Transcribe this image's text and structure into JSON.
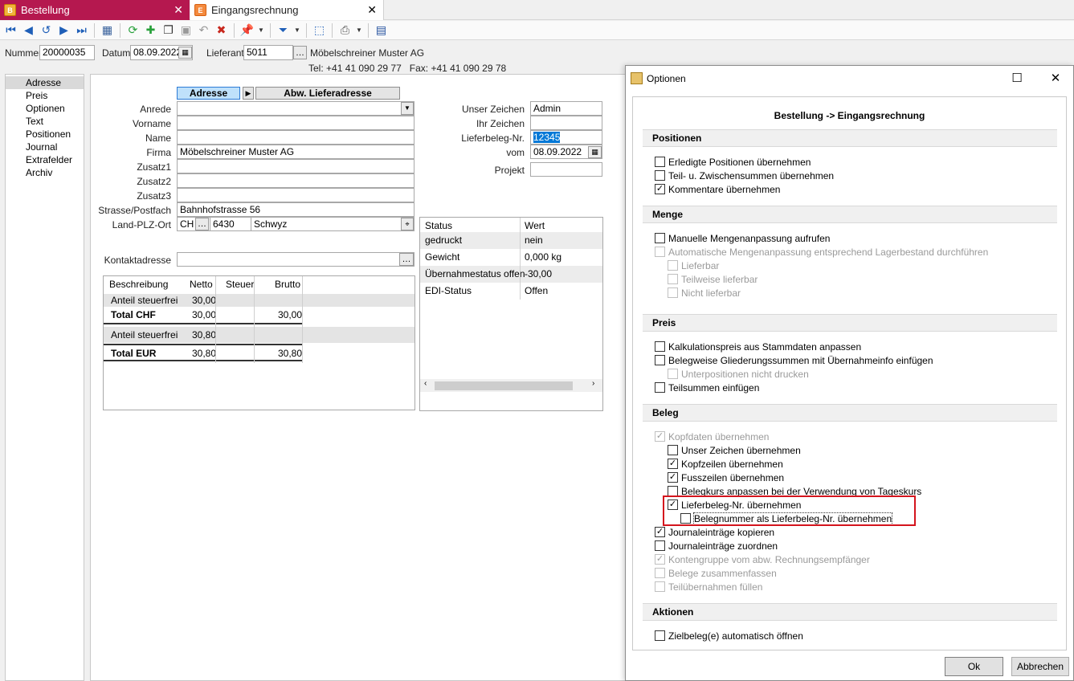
{
  "tabs": [
    {
      "label": "Bestellung",
      "icon": "document-icon",
      "active": true
    },
    {
      "label": "Eingangsrechnung",
      "icon": "document-icon",
      "active": false
    }
  ],
  "header": {
    "nummer_label": "Nummer",
    "nummer_value": "20000035",
    "datum_label": "Datum",
    "datum_value": "08.09.2022",
    "lieferant_label": "Lieferant",
    "lieferant_value": "5011",
    "lieferant_name": "Möbelschreiner Muster AG",
    "contact_line": "Tel: +41 41 090 29 77   Fax: +41 41 090 29 78"
  },
  "nav": [
    "Adresse",
    "Preis",
    "Optionen",
    "Text",
    "Positionen",
    "Journal",
    "Extrafelder",
    "Archiv"
  ],
  "address": {
    "seg_active": "Adresse",
    "seg_other": "Abw. Lieferadresse",
    "anrede_label": "Anrede",
    "vorname_label": "Vorname",
    "name_label": "Name",
    "firma_label": "Firma",
    "firma_value": "Möbelschreiner Muster AG",
    "zusatz1_label": "Zusatz1",
    "zusatz2_label": "Zusatz2",
    "zusatz3_label": "Zusatz3",
    "strasse_label": "Strasse/Postfach",
    "strasse_value": "Bahnhofstrasse 56",
    "land_label": "Land-PLZ-Ort",
    "land_value": "CH",
    "plz_value": "6430",
    "ort_value": "Schwyz",
    "kontakt_label": "Kontaktadresse"
  },
  "right_fields": {
    "unser_zeichen_label": "Unser Zeichen",
    "unser_zeichen_value": "Admin",
    "ihr_zeichen_label": "Ihr Zeichen",
    "lieferbeleg_label": "Lieferbeleg-Nr.",
    "lieferbeleg_value": "12345",
    "vom_label": "vom",
    "vom_value": "08.09.2022",
    "projekt_label": "Projekt"
  },
  "totals": {
    "headers": [
      "Beschreibung",
      "Netto",
      "Steuer",
      "Brutto"
    ],
    "rows": [
      {
        "desc": "Anteil steuerfrei",
        "netto": "30,00",
        "steuer": "",
        "brutto": "",
        "bold": false
      },
      {
        "desc": "Total CHF",
        "netto": "30,00",
        "steuer": "",
        "brutto": "30,00",
        "bold": true
      },
      {
        "desc": "Anteil steuerfrei",
        "netto": "30,80",
        "steuer": "",
        "brutto": "",
        "bold": false
      },
      {
        "desc": "Total EUR",
        "netto": "30,80",
        "steuer": "",
        "brutto": "30,80",
        "bold": true
      }
    ]
  },
  "status_grid": {
    "headers": [
      "Status",
      "Wert"
    ],
    "rows": [
      [
        "gedruckt",
        "nein"
      ],
      [
        "Gewicht",
        "0,000 kg"
      ],
      [
        "Übernahmestatus offen",
        "-30,00"
      ],
      [
        "EDI-Status",
        "Offen"
      ]
    ]
  },
  "dialog": {
    "title": "Optionen",
    "heading": "Bestellung -> Eingangsrechnung",
    "sections": {
      "positionen": "Positionen",
      "menge": "Menge",
      "preis": "Preis",
      "beleg": "Beleg",
      "aktionen": "Aktionen"
    },
    "options": {
      "erledigte": "Erledigte Positionen übernehmen",
      "teilzwischen": "Teil- u. Zwischensummen übernehmen",
      "kommentare": "Kommentare übernehmen",
      "manuelle": "Manuelle Mengenanpassung aufrufen",
      "automatische": "Automatische Mengenanpassung entsprechend Lagerbestand durchführen",
      "lieferbar": "Lieferbar",
      "teilweise": "Teilweise lieferbar",
      "nicht": "Nicht lieferbar",
      "kalkulation": "Kalkulationspreis aus Stammdaten anpassen",
      "gliederung": "Belegweise Gliederungssummen mit Übernahmeinfo einfügen",
      "unterpositionen": "Unterpositionen nicht drucken",
      "teilsummen": "Teilsummen einfügen",
      "kopfdaten": "Kopfdaten übernehmen",
      "unser_zeichen": "Unser Zeichen übernehmen",
      "kopfzeilen": "Kopfzeilen übernehmen",
      "fusszeilen": "Fusszeilen übernehmen",
      "belegkurs": "Belegkurs anpassen bei der Verwendung von Tageskurs",
      "lieferbeleg": "Lieferbeleg-Nr. übernehmen",
      "belegnummer": "Belegnummer als Lieferbeleg-Nr. übernehmen",
      "journal_kopieren": "Journaleinträge kopieren",
      "journal_zuordnen": "Journaleinträge zuordnen",
      "kontengruppe": "Kontengruppe vom abw. Rechnungsempfänger",
      "zusammenfassen": "Belege zusammenfassen",
      "teiluebernahmen": "Teilübernahmen füllen",
      "zielbeleg": "Zielbeleg(e) automatisch öffnen"
    },
    "ok_label": "Ok",
    "cancel_label": "Abbrechen"
  }
}
